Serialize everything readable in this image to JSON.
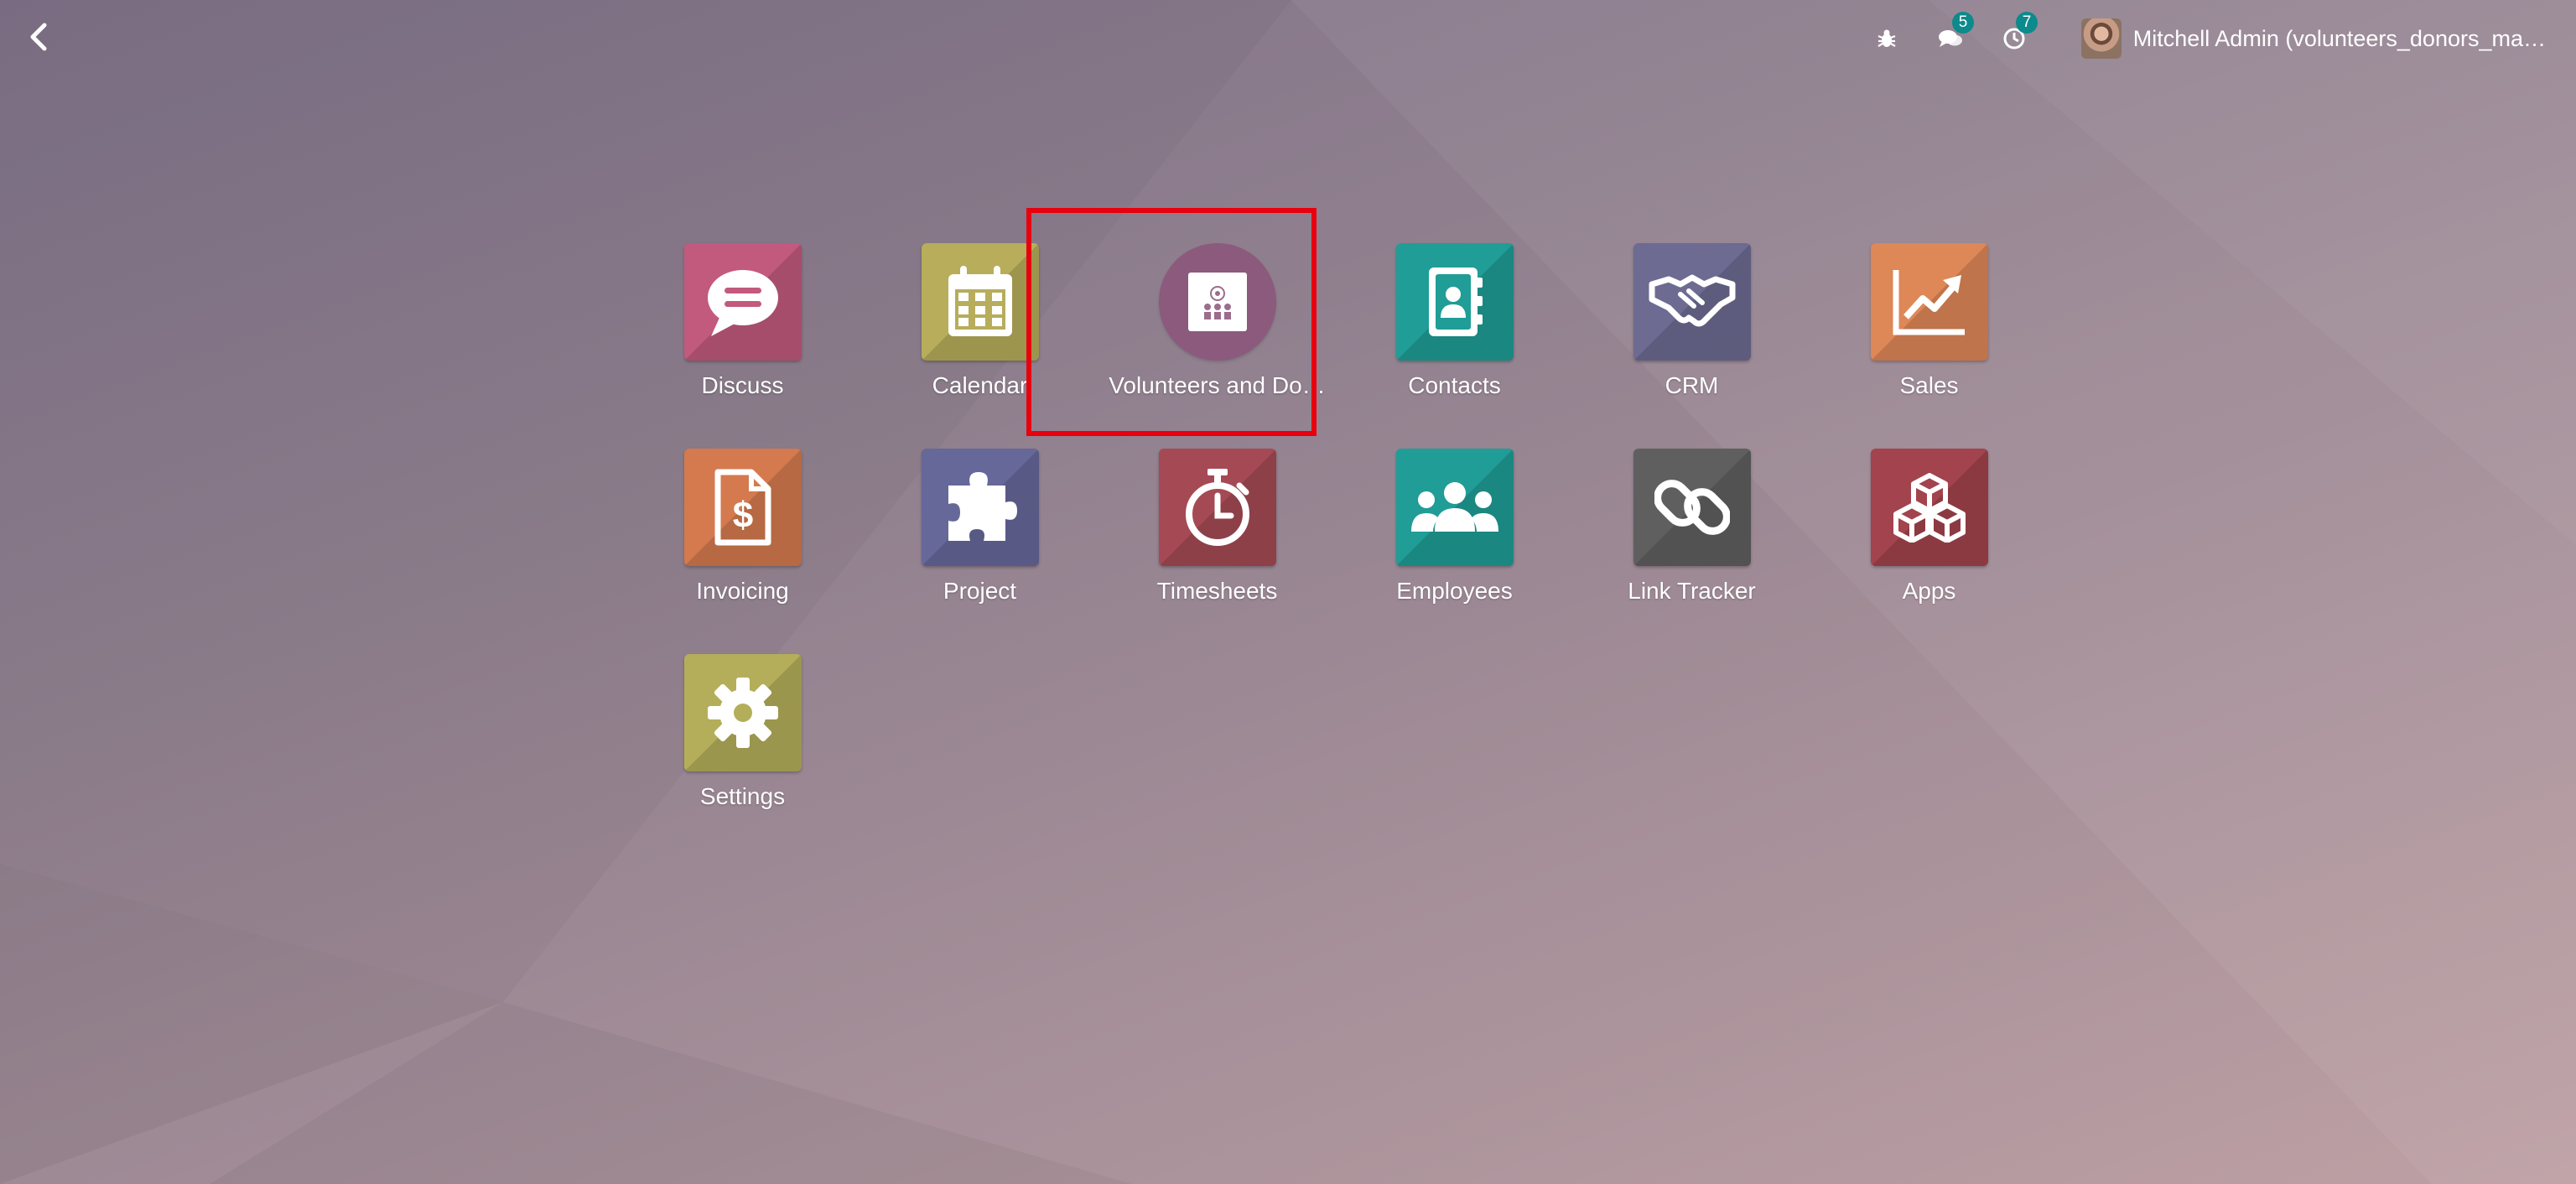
{
  "topbar": {
    "back_icon": "chevron-left-icon",
    "debug_icon": "bug-icon",
    "messages_icon": "comments-icon",
    "messages_count": "5",
    "activities_icon": "clock-icon",
    "activities_count": "7",
    "user_name": "Mitchell Admin (volunteers_donors_ma…"
  },
  "apps": [
    {
      "label": "Discuss",
      "icon": "chat-bubble-icon",
      "color": "#c25a7e"
    },
    {
      "label": "Calendar",
      "icon": "calendar-icon",
      "color": "#b7ad5b"
    },
    {
      "label": "Volunteers and Do…",
      "icon": "volunteers-icon",
      "color": "#8b5a7c"
    },
    {
      "label": "Contacts",
      "icon": "address-book-icon",
      "color": "#1f9d96"
    },
    {
      "label": "CRM",
      "icon": "handshake-icon",
      "color": "#6d6b92"
    },
    {
      "label": "Sales",
      "icon": "chart-up-icon",
      "color": "#de8757"
    },
    {
      "label": "Invoicing",
      "icon": "invoice-dollar-icon",
      "color": "#d47a4e"
    },
    {
      "label": "Project",
      "icon": "puzzle-icon",
      "color": "#66689a"
    },
    {
      "label": "Timesheets",
      "icon": "stopwatch-icon",
      "color": "#a54a55"
    },
    {
      "label": "Employees",
      "icon": "users-icon",
      "color": "#1f9d96"
    },
    {
      "label": "Link Tracker",
      "icon": "link-icon",
      "color": "#5f5f5f"
    },
    {
      "label": "Apps",
      "icon": "cubes-icon",
      "color": "#a3434d"
    },
    {
      "label": "Settings",
      "icon": "gear-icon",
      "color": "#b4ae5a"
    }
  ],
  "highlight_color": "#e8000e",
  "badge_color": "#0c8a8c"
}
